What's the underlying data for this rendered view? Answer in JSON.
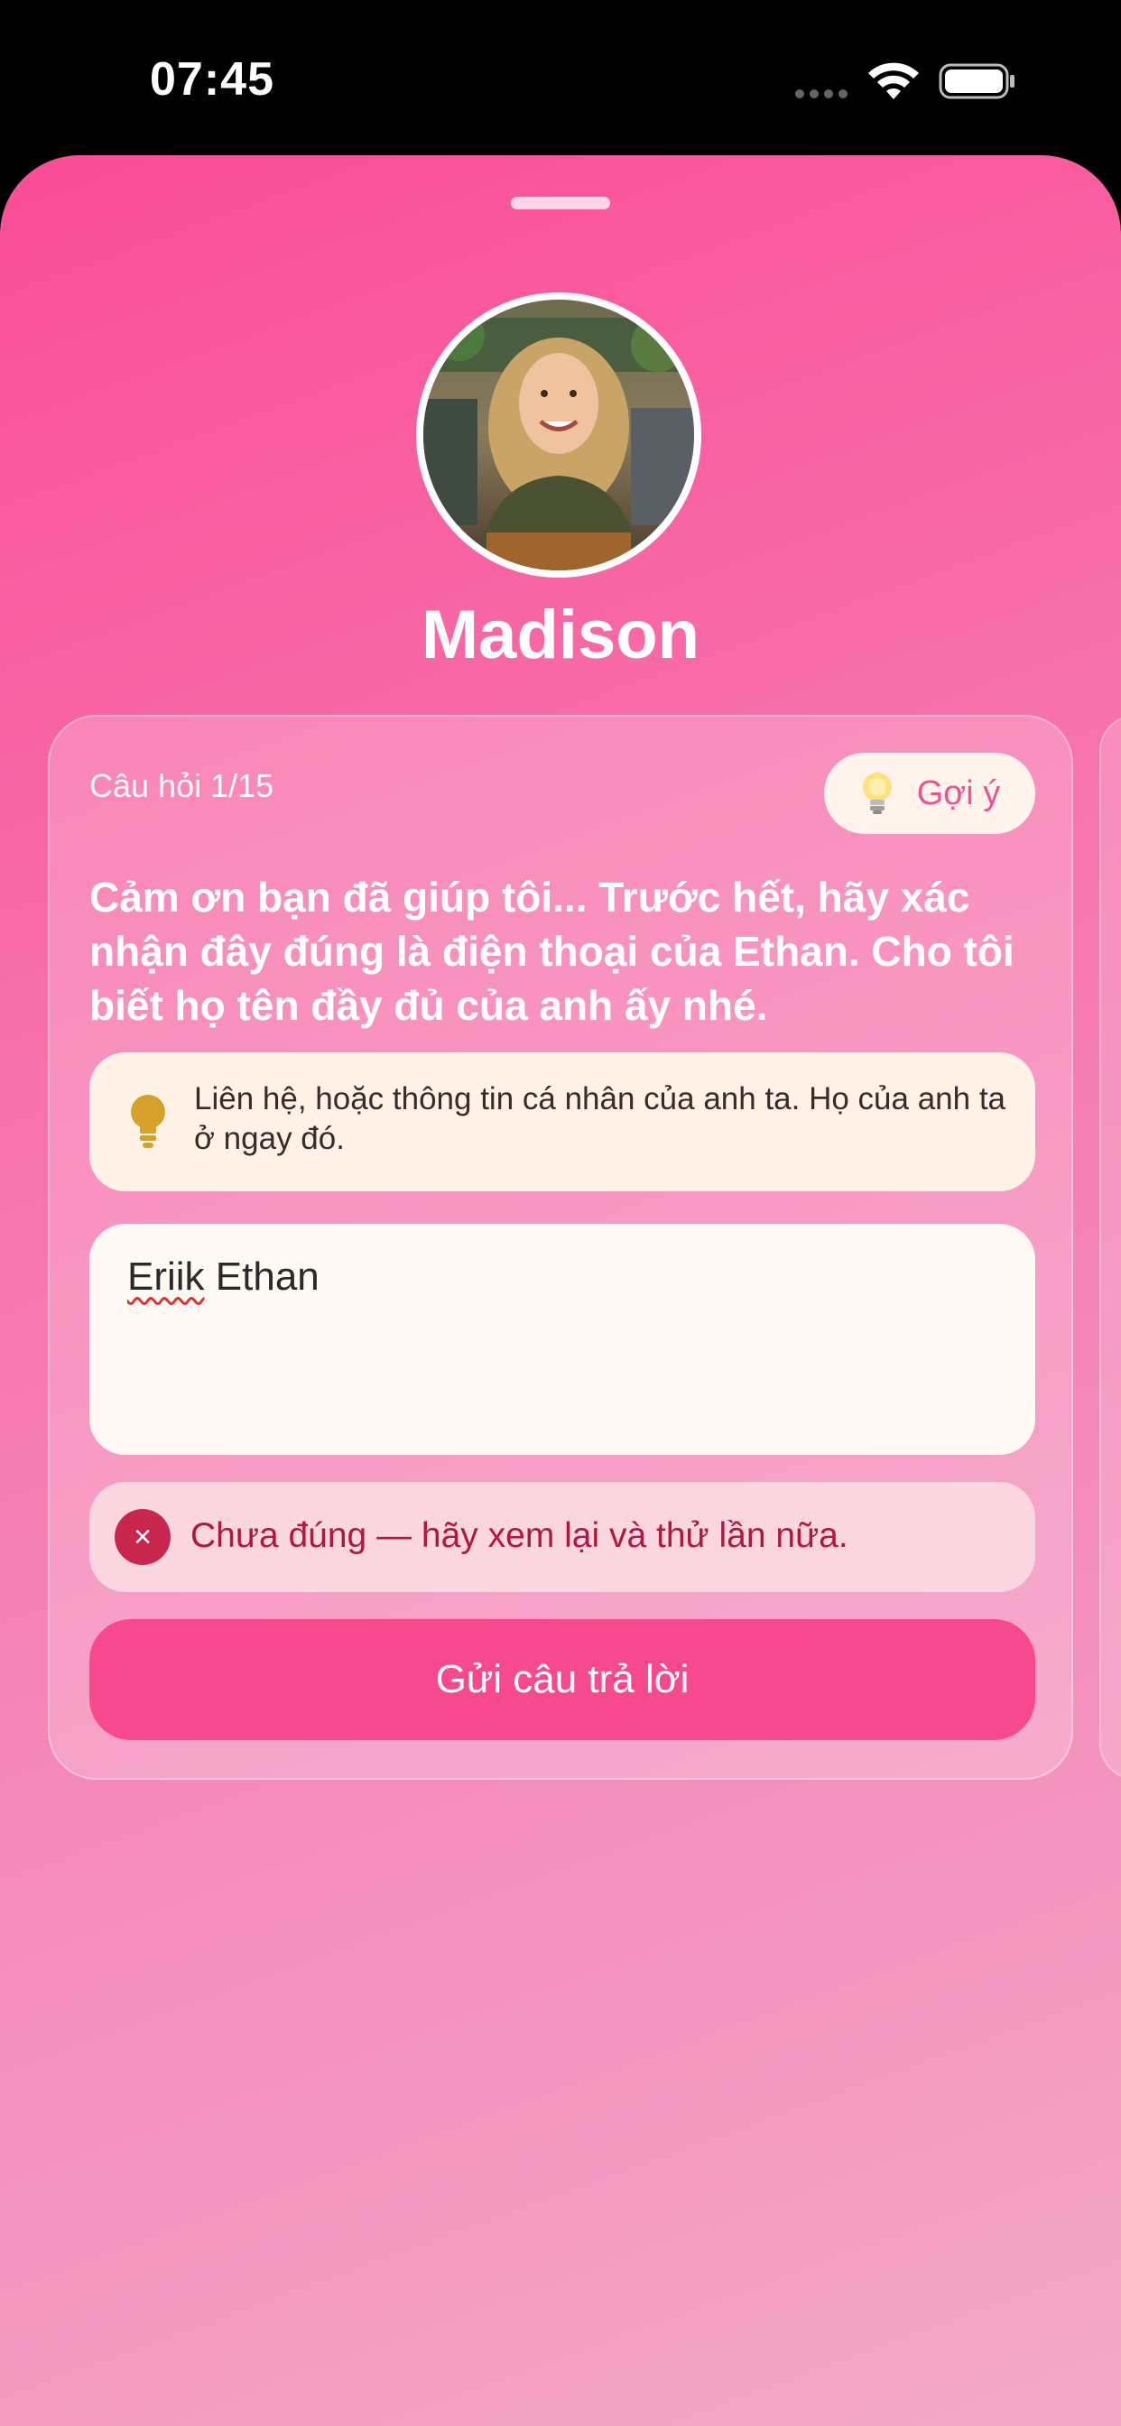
{
  "status_bar": {
    "time": "07:45",
    "signal_icon": "signal-dots-icon",
    "wifi_icon": "wifi-icon",
    "battery_icon": "battery-icon"
  },
  "profile": {
    "name": "Madison",
    "avatar_icon": "profile-photo"
  },
  "question": {
    "counter": "Câu hỏi 1/15",
    "hint_button_label": "Gợi ý",
    "text": "Cảm ơn bạn đã giúp tôi... Trước hết, hãy xác nhận đây đúng là điện thoại của Ethan. Cho tôi biết họ tên đầy đủ của anh ấy nhé.",
    "hint_text": "Liên hệ, hoặc thông tin cá nhân của anh ta. Họ của anh ta ở ngay đó.",
    "answer_misspelled": "Eriik",
    "answer_rest": " Ethan",
    "error_message": "Chưa đúng — hãy xem lại và thử lần nữa.",
    "error_icon_glyph": "×",
    "submit_label": "Gửi câu trả lời"
  },
  "colors": {
    "accent": "#f74a8e",
    "error": "#c8264e",
    "hint_icon": "#d6a02a"
  }
}
